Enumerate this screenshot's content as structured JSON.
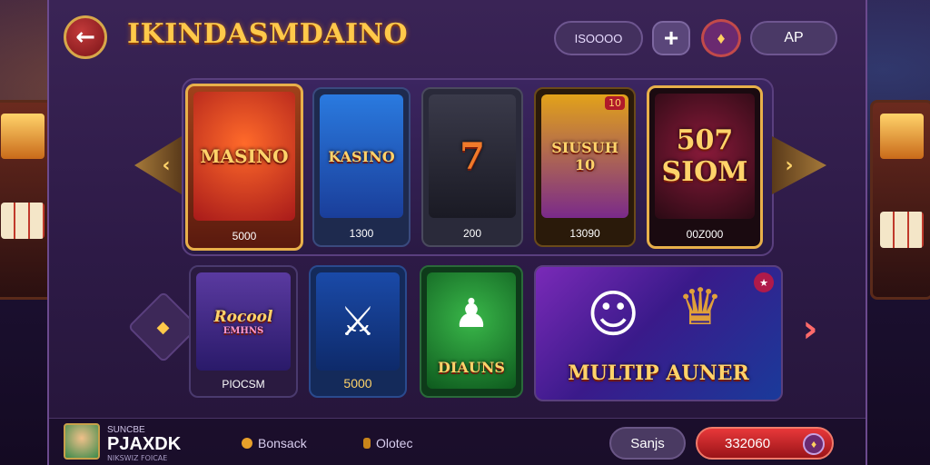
{
  "header": {
    "title": "IKINDASMDAINO",
    "balance": "ISOOOO",
    "account_label": "AP",
    "icons": {
      "back": "back-arrow-icon",
      "plus": "plus-icon",
      "dice": "dice-icon"
    }
  },
  "row1": [
    {
      "title": "MASINO",
      "value": "5000",
      "badge": ""
    },
    {
      "title": "KASINO",
      "value": "1300",
      "badge": ""
    },
    {
      "title": "7",
      "value": "200",
      "badge": ""
    },
    {
      "title": "SIUSUH 10",
      "value": "13090",
      "badge": "10"
    },
    {
      "title": "507 SIOM",
      "value": "00Z000",
      "badge": ""
    }
  ],
  "row2": [
    {
      "title": "Rocool",
      "subtitle": "EMHNS",
      "value": "PIOCSM"
    },
    {
      "title": "",
      "value": "5000"
    },
    {
      "title": "DIAUNS",
      "value": ""
    },
    {
      "title": "MULTIP AUNER",
      "value": ""
    }
  ],
  "footer": {
    "user_label": "SUNCBE",
    "user_name": "PJAXDK",
    "user_sub": "NIKSWIZ FOICAE",
    "link_bonus": "Bonsack",
    "link_deposit": "Olotec",
    "sign_label": "Sanjs",
    "wallet_amount": "332060"
  },
  "colors": {
    "accent_gold": "#ffc94a",
    "accent_red": "#e8383a",
    "panel_bg": "#2d1a46"
  }
}
